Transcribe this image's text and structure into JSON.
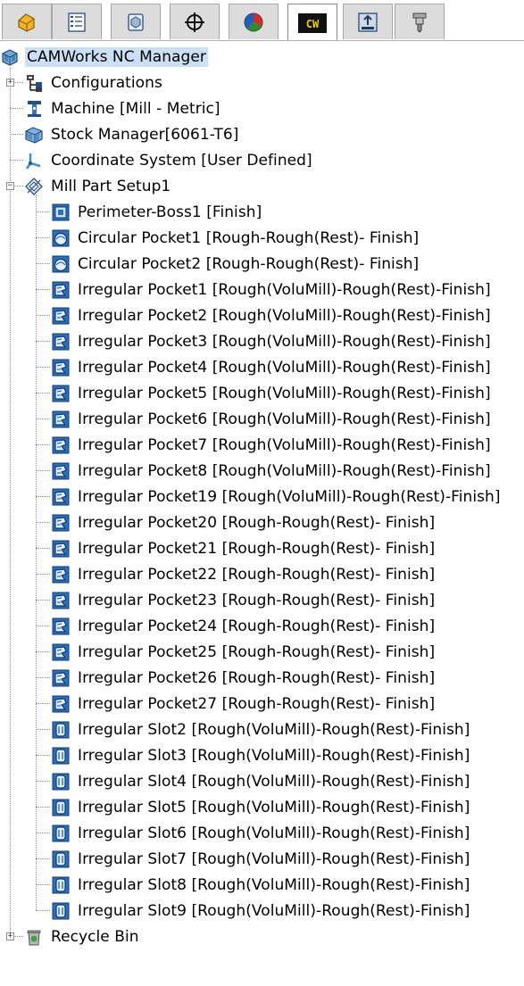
{
  "tabs": [
    {
      "icon": "feature-tree-icon"
    },
    {
      "icon": "property-manager-icon"
    },
    {
      "icon": "configuration-manager-icon"
    },
    {
      "icon": "dimxpert-icon"
    },
    {
      "icon": "display-manager-icon"
    },
    {
      "icon": "camworks-feature-tree-icon",
      "label": "CW",
      "active": true
    },
    {
      "icon": "camworks-operation-tree-icon"
    },
    {
      "icon": "camworks-toolpath-tree-icon"
    }
  ],
  "tree": {
    "root": {
      "label": "CAMWorks NC Manager"
    },
    "top_items": [
      {
        "label": "Configurations",
        "icon": "configurations-icon"
      },
      {
        "label": "Machine [Mill - Metric]",
        "icon": "machine-icon"
      },
      {
        "label": "Stock Manager[6061-T6]",
        "icon": "stock-manager-icon"
      },
      {
        "label": "Coordinate System [User Defined]",
        "icon": "coordinate-system-icon"
      },
      {
        "label": "Mill Part Setup1",
        "icon": "mill-part-setup-icon"
      }
    ],
    "features": [
      {
        "label": "Perimeter-Boss1 [Finish]",
        "icon": "boss-feature-icon"
      },
      {
        "label": "Circular Pocket1 [Rough-Rough(Rest)- Finish]",
        "icon": "circular-pocket-icon"
      },
      {
        "label": "Circular Pocket2 [Rough-Rough(Rest)- Finish]",
        "icon": "circular-pocket-icon"
      },
      {
        "label": "Irregular Pocket1 [Rough(VoluMill)-Rough(Rest)-Finish]",
        "icon": "irregular-pocket-icon"
      },
      {
        "label": "Irregular Pocket2 [Rough(VoluMill)-Rough(Rest)-Finish]",
        "icon": "irregular-pocket-icon"
      },
      {
        "label": "Irregular Pocket3 [Rough(VoluMill)-Rough(Rest)-Finish]",
        "icon": "irregular-pocket-icon"
      },
      {
        "label": "Irregular Pocket4 [Rough(VoluMill)-Rough(Rest)-Finish]",
        "icon": "irregular-pocket-icon"
      },
      {
        "label": "Irregular Pocket5 [Rough(VoluMill)-Rough(Rest)-Finish]",
        "icon": "irregular-pocket-icon"
      },
      {
        "label": "Irregular Pocket6 [Rough(VoluMill)-Rough(Rest)-Finish]",
        "icon": "irregular-pocket-icon"
      },
      {
        "label": "Irregular Pocket7 [Rough(VoluMill)-Rough(Rest)-Finish]",
        "icon": "irregular-pocket-icon"
      },
      {
        "label": "Irregular Pocket8 [Rough(VoluMill)-Rough(Rest)-Finish]",
        "icon": "irregular-pocket-icon"
      },
      {
        "label": "Irregular Pocket19 [Rough(VoluMill)-Rough(Rest)-Finish]",
        "icon": "irregular-pocket-icon"
      },
      {
        "label": "Irregular Pocket20 [Rough-Rough(Rest)- Finish]",
        "icon": "irregular-pocket-icon"
      },
      {
        "label": "Irregular Pocket21 [Rough-Rough(Rest)- Finish]",
        "icon": "irregular-pocket-icon"
      },
      {
        "label": "Irregular Pocket22 [Rough-Rough(Rest)- Finish]",
        "icon": "irregular-pocket-icon"
      },
      {
        "label": "Irregular Pocket23 [Rough-Rough(Rest)- Finish]",
        "icon": "irregular-pocket-icon"
      },
      {
        "label": "Irregular Pocket24 [Rough-Rough(Rest)- Finish]",
        "icon": "irregular-pocket-icon"
      },
      {
        "label": "Irregular Pocket25 [Rough-Rough(Rest)- Finish]",
        "icon": "irregular-pocket-icon"
      },
      {
        "label": "Irregular Pocket26 [Rough-Rough(Rest)- Finish]",
        "icon": "irregular-pocket-icon"
      },
      {
        "label": "Irregular Pocket27 [Rough-Rough(Rest)- Finish]",
        "icon": "irregular-pocket-icon"
      },
      {
        "label": "Irregular Slot2 [Rough(VoluMill)-Rough(Rest)-Finish]",
        "icon": "irregular-slot-icon"
      },
      {
        "label": "Irregular Slot3 [Rough(VoluMill)-Rough(Rest)-Finish]",
        "icon": "irregular-slot-icon"
      },
      {
        "label": "Irregular Slot4 [Rough(VoluMill)-Rough(Rest)-Finish]",
        "icon": "irregular-slot-icon"
      },
      {
        "label": "Irregular Slot5 [Rough(VoluMill)-Rough(Rest)-Finish]",
        "icon": "irregular-slot-icon"
      },
      {
        "label": "Irregular Slot6 [Rough(VoluMill)-Rough(Rest)-Finish]",
        "icon": "irregular-slot-icon"
      },
      {
        "label": "Irregular Slot7 [Rough(VoluMill)-Rough(Rest)-Finish]",
        "icon": "irregular-slot-icon"
      },
      {
        "label": "Irregular Slot8 [Rough(VoluMill)-Rough(Rest)-Finish]",
        "icon": "irregular-slot-icon"
      },
      {
        "label": "Irregular Slot9 [Rough(VoluMill)-Rough(Rest)-Finish]",
        "icon": "irregular-slot-icon"
      }
    ],
    "bottom_items": [
      {
        "label": "Recycle Bin",
        "icon": "recycle-bin-icon"
      }
    ]
  },
  "colors": {
    "selection": "#cce0f5",
    "feature_blue": "#1e5fb4",
    "tab_bg": "#dcdcdc"
  }
}
